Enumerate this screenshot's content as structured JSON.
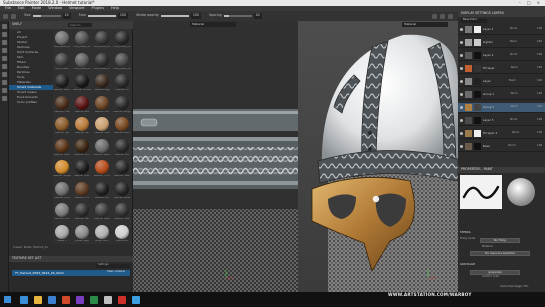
{
  "window": {
    "title": "Substance Painter 2018.2.0 - Helmet tutorial*",
    "controls": [
      "–",
      "□",
      "×"
    ]
  },
  "menu": [
    "File",
    "Edit",
    "Mode",
    "Window",
    "Viewport",
    "Plugins",
    "Help"
  ],
  "toolbar": {
    "size_label": "Size",
    "size_value": "10",
    "flow_label": "Flow",
    "flow_value": "100",
    "stroke_opacity_label": "Stroke opacity",
    "stroke_opacity_value": "100",
    "spacing_label": "Spacing",
    "spacing_value": "20",
    "angle_label": "",
    "size_fill": 0.3,
    "flow_fill": 1.0,
    "opacity_fill": 1.0,
    "spacing_fill": 0.2
  },
  "shelf": {
    "title": "SHELF",
    "search_placeholder": "Search...",
    "categories": [
      "All",
      "Project",
      "Starter",
      "Textures",
      "Hard Surfaces",
      "Skin",
      "Filters",
      "Brushes",
      "Particles",
      "Tools",
      "Materials",
      "Smart materials",
      "Smart masks",
      "Environments",
      "Color profiles"
    ],
    "selected_category": 11,
    "materials": [
      {
        "label": "PBR_Metal_01",
        "color": "#6c6c6c"
      },
      {
        "label": "PBR_Metal_02",
        "color": "#4d4d4d"
      },
      {
        "label": "PBR_Metal_03",
        "color": "#353535"
      },
      {
        "label": "PBR_Metal_04",
        "color": "#2a2a2a"
      },
      {
        "label": "PBR_Plastic",
        "color": "#3d3d3d"
      },
      {
        "label": "PBR_Metal_06",
        "color": "#5a5a5a"
      },
      {
        "label": "PBR_Metal_07",
        "color": "#2f2f2f"
      },
      {
        "label": "PBR_Metal_08",
        "color": "#464646"
      },
      {
        "label": "Leather Black",
        "color": "#202020"
      },
      {
        "label": "Leather Cracked",
        "color": "#1a1a1a"
      },
      {
        "label": "Leather Bag",
        "color": "#3a2a1e"
      },
      {
        "label": "Leather Cu",
        "color": "#2b2b2b"
      },
      {
        "label": "Leather Fine",
        "color": "#4a2d1a"
      },
      {
        "label": "Leather Red",
        "color": "#5a1414"
      },
      {
        "label": "Leather Soft",
        "color": "#6b4424"
      },
      {
        "label": "Leather Rough",
        "color": "#2c2c2c"
      },
      {
        "label": "Leather Fab",
        "color": "#8a5a2a"
      },
      {
        "label": "Leather Tan",
        "color": "#b97a3a"
      },
      {
        "label": "Leather Sofa",
        "color": "#c9a070"
      },
      {
        "label": "Leather Worn",
        "color": "#7a4a22"
      },
      {
        "label": "Leather Padd",
        "color": "#5a3418"
      },
      {
        "label": "Leather Rich",
        "color": "#3a2410"
      },
      {
        "label": "Leather Seam",
        "color": "#6a6a6a"
      },
      {
        "label": "Leather Stit",
        "color": "#2a2a2a"
      },
      {
        "label": "Leather Straps",
        "color": "#d08a2a"
      },
      {
        "label": "Leather Scuff",
        "color": "#1c1c1c"
      },
      {
        "label": "Leather Thick",
        "color": "#b44a1a"
      },
      {
        "label": "Leather Used",
        "color": "#262626"
      },
      {
        "label": "Leather Uniq",
        "color": "#6e6e6e"
      },
      {
        "label": "Leather Fin2",
        "color": "#5c3a20"
      },
      {
        "label": "Leather Dirt",
        "color": "#202020"
      },
      {
        "label": "Leather Gloss",
        "color": "#242424"
      },
      {
        "label": "Leather Vint",
        "color": "#7a7a7a"
      },
      {
        "label": "Leather Mat",
        "color": "#2f2f2f"
      },
      {
        "label": "Leather Pleat",
        "color": "#3c3c3c"
      },
      {
        "label": "Leather Hole",
        "color": "#333333"
      },
      {
        "label": "Metal 1",
        "color": "#a8a8a8"
      },
      {
        "label": "Metal Edge",
        "color": "#8a8a8a"
      },
      {
        "label": "Metal Worn",
        "color": "#b0b0b0"
      },
      {
        "label": "Metal Iron",
        "color": "#cfcfcf"
      }
    ],
    "footer": "preset: Metal_Helmet_01"
  },
  "texture_set": {
    "title": "TEXTURE SET LIST",
    "filter_label": "Settings",
    "row_label": "TT_Helmet_0584_0624_2K_0022",
    "shader_label": "Main shader"
  },
  "viewport2d": {
    "mode_label": "Material"
  },
  "viewport3d": {
    "mode_label": "Material"
  },
  "layers": {
    "title": "DISPLAY SETTINGS  LAYERS",
    "blend_label": "Base Color",
    "items": [
      {
        "name": "Layer 1",
        "blend": "Norm",
        "opacity": "100",
        "thumb": "#7a7a7a",
        "mask": "#eeeeee"
      },
      {
        "name": "Lighter",
        "blend": "Norm",
        "opacity": "100",
        "thumb": "#a0a0a0",
        "mask": "#cccccc"
      },
      {
        "name": "Layer 2",
        "blend": "Norm",
        "opacity": "100",
        "thumb": "#5a5a5a",
        "mask": "#111111"
      },
      {
        "name": "Fill layer",
        "blend": "Norm",
        "opacity": "100",
        "thumb": "#c06030",
        "mask": "#333333"
      },
      {
        "name": "Layer",
        "blend": "Norm",
        "opacity": "100",
        "thumb": "#8a8a8a",
        "mask": "#222222"
      },
      {
        "name": "Group 1",
        "blend": "Norm",
        "opacity": "100",
        "thumb": "#6a6a6a",
        "mask": "#111111"
      },
      {
        "name": "Group 2",
        "blend": "Norm",
        "opacity": "100",
        "thumb": "#b08040",
        "mask": "#444444"
      },
      {
        "name": "Layer 3",
        "blend": "Norm",
        "opacity": "100",
        "thumb": "#4a4a4a",
        "mask": "#111111"
      },
      {
        "name": "Fill layer 2",
        "blend": "Norm",
        "opacity": "100",
        "thumb": "#9a7a4a",
        "mask": "#eeeeee"
      },
      {
        "name": "Base",
        "blend": "Norm",
        "opacity": "100",
        "thumb": "#6a5a4a",
        "mask": "#111111"
      }
    ],
    "selected": 6
  },
  "properties": {
    "title": "PROPERTIES - PAINT",
    "stencil_title": "STENCIL",
    "stencil_label": "Tiling mode",
    "stencil_value": "No Tiling",
    "material_label": "Material",
    "material_value": "No resource selected",
    "grayscale_title": "GRAYSCALE",
    "grayscale_btn": "grayscale",
    "grayscale_sub": "uniform color"
  },
  "status": {
    "text": "Cache Disk Usage: 75%"
  },
  "watermark": "WWW.ARTSTATION.COM/WARBOY",
  "taskbar_icons": [
    "#3a8fd8",
    "#e9b640",
    "#3d7fd0",
    "#d14a2a",
    "#7a3fc0",
    "#2a8a4a",
    "#c0c0c0",
    "#d0302a",
    "#3aa0e0"
  ],
  "colors": {
    "accent": "#1f5a8a"
  }
}
